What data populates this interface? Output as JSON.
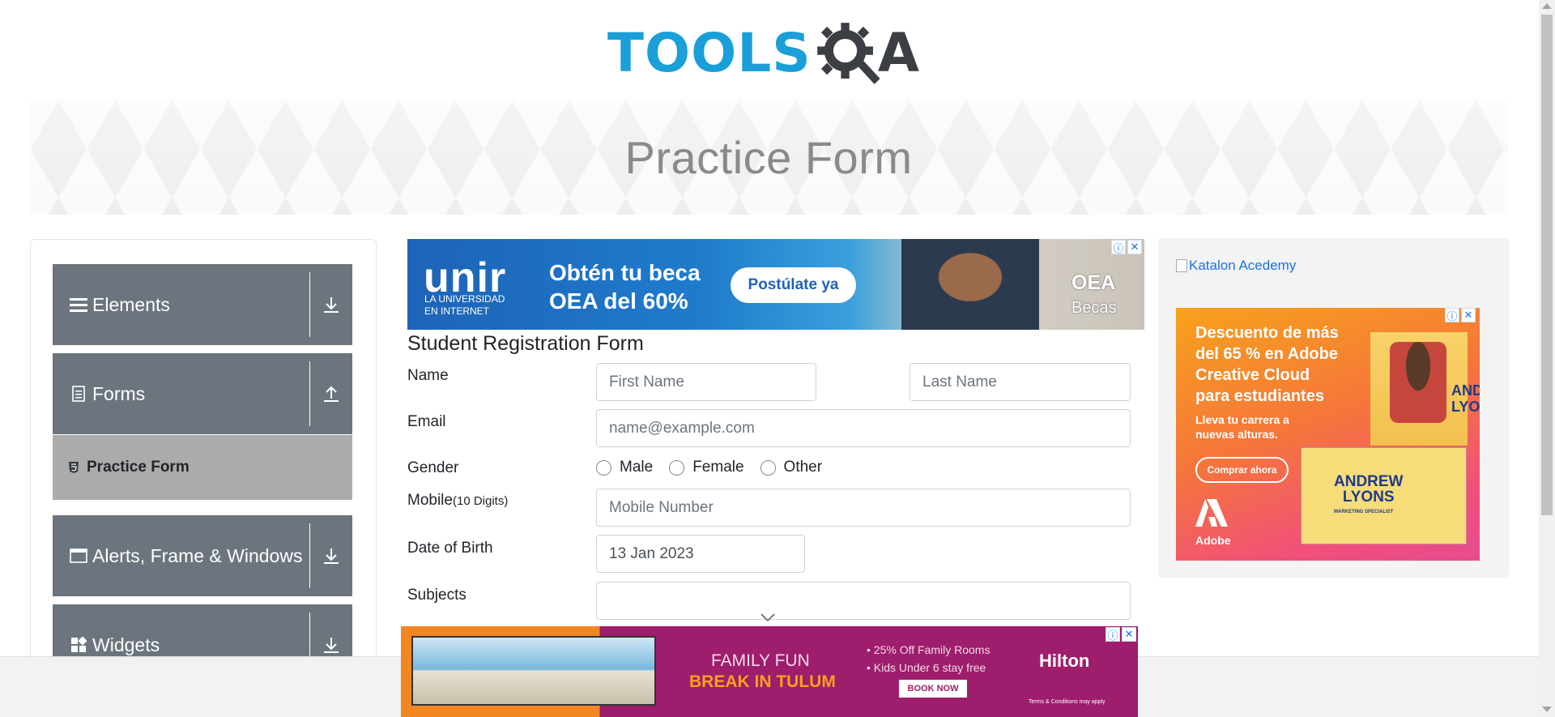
{
  "logo": {
    "tools_text": "TOOLS",
    "a_text": "A"
  },
  "banner": {
    "title": "Practice Form"
  },
  "sidebar": {
    "groups": [
      {
        "label": "Elements",
        "icon": "hamburger-icon",
        "arrow": "download-icon"
      },
      {
        "label": "Forms",
        "icon": "document-icon",
        "arrow": "upload-icon"
      },
      {
        "label": "Alerts, Frame & Windows",
        "icon": "window-icon",
        "arrow": "download-icon"
      },
      {
        "label": "Widgets",
        "icon": "widgets-icon",
        "arrow": "download-icon"
      }
    ],
    "active_item": {
      "label": "Practice Form",
      "icon": "html5-icon"
    }
  },
  "ad_top": {
    "brand": "unir",
    "brand_sub_1": "LA UNIVERSIDAD",
    "brand_sub_2": "EN INTERNET",
    "headline_1": "Obtén tu beca",
    "headline_2": "OEA del 60%",
    "cta": "Postúlate ya",
    "partner": "OEA",
    "partner_sub": "Becas"
  },
  "form": {
    "title": "Student Registration Form",
    "name_label": "Name",
    "first_name_placeholder": "First Name",
    "last_name_placeholder": "Last Name",
    "email_label": "Email",
    "email_placeholder": "name@example.com",
    "gender_label": "Gender",
    "gender_options": [
      "Male",
      "Female",
      "Other"
    ],
    "mobile_label": "Mobile",
    "mobile_hint": "(10 Digits)",
    "mobile_placeholder": "Mobile Number",
    "dob_label": "Date of Birth",
    "dob_value": "13 Jan 2023",
    "subjects_label": "Subjects",
    "subjects_value": ""
  },
  "right_ad": {
    "link_text": "Katalon Acedemy",
    "headline_1": "Descuento de más",
    "headline_2": "del 65 % en Adobe",
    "headline_3": "Creative Cloud",
    "headline_4": "para estudiantes",
    "sub_1": "Lleva tu carrera a",
    "sub_2": "nuevas alturas.",
    "cta": "Comprar ahora",
    "brand": "Adobe",
    "card_name_1": "ANDREW",
    "card_name_2": "LYONS",
    "card_role": "MARKETING SPECIALIST",
    "side_name_1": "AND",
    "side_name_2": "LYO"
  },
  "bottom_ad": {
    "headline_1": "FAMILY FUN",
    "headline_2": "BREAK IN TULUM",
    "bullet_1": "• 25% Off Family Rooms",
    "bullet_2": "• Kids Under 6 stay free",
    "cta": "BOOK NOW",
    "brand": "Hilton",
    "terms": "Terms & Conditions may apply"
  },
  "colors": {
    "logo_blue": "#1a9fd8",
    "logo_dark": "#3b3f44",
    "sidebar_group": "#6c757d",
    "sidebar_active": "#ababab",
    "link": "#1a73e8"
  }
}
